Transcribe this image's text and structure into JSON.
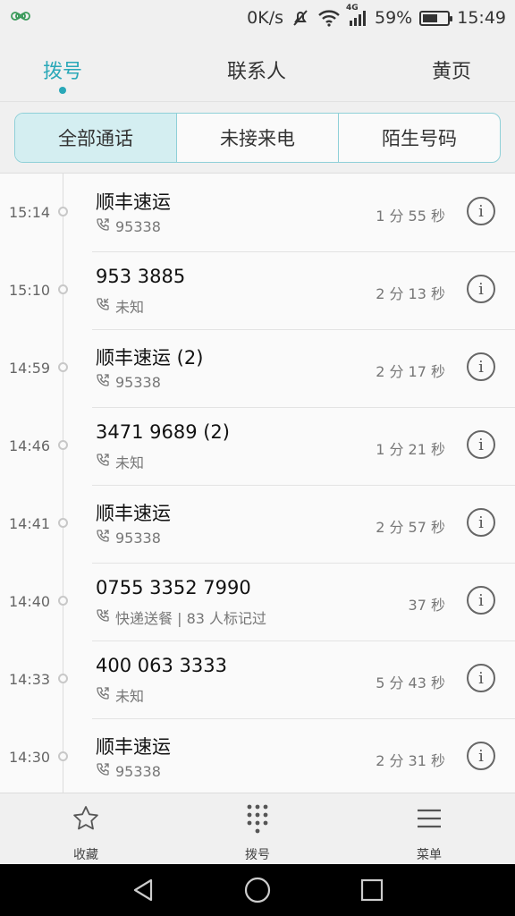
{
  "status_bar": {
    "app_icon": "infinity-icon",
    "speed": "0K/s",
    "network": "4G",
    "battery": "59%",
    "battery_level": 0.59,
    "time": "15:49"
  },
  "tabs": [
    {
      "label": "拨号",
      "active": true
    },
    {
      "label": "联系人",
      "active": false
    },
    {
      "label": "黄页",
      "active": false
    }
  ],
  "filter": [
    {
      "label": "全部通话",
      "active": true
    },
    {
      "label": "未接来电",
      "active": false
    },
    {
      "label": "陌生号码",
      "active": false
    }
  ],
  "calls": [
    {
      "time": "15:14",
      "name": "顺丰速运",
      "direction": "outgoing",
      "detail": "95338",
      "duration": "1 分 55 秒"
    },
    {
      "time": "15:10",
      "name": "953 3885",
      "direction": "incoming",
      "detail": "未知",
      "duration": "2 分 13 秒"
    },
    {
      "time": "14:59",
      "name": "顺丰速运 (2)",
      "direction": "outgoing",
      "detail": "95338",
      "duration": "2 分 17 秒"
    },
    {
      "time": "14:46",
      "name": "3471 9689 (2)",
      "direction": "outgoing",
      "detail": "未知",
      "duration": "1 分 21 秒"
    },
    {
      "time": "14:41",
      "name": "顺丰速运",
      "direction": "outgoing",
      "detail": "95338",
      "duration": "2 分 57 秒"
    },
    {
      "time": "14:40",
      "name": "0755 3352 7990",
      "direction": "incoming",
      "detail": "快递送餐 | 83 人标记过",
      "duration": "37 秒"
    },
    {
      "time": "14:33",
      "name": "400 063 3333",
      "direction": "outgoing",
      "detail": "未知",
      "duration": "5 分 43 秒"
    },
    {
      "time": "14:30",
      "name": "顺丰速运",
      "direction": "outgoing",
      "detail": "95338",
      "duration": "2 分 31 秒"
    }
  ],
  "actions": [
    {
      "label": "收藏",
      "icon": "star-icon"
    },
    {
      "label": "拨号",
      "icon": "dialpad-icon"
    },
    {
      "label": "菜单",
      "icon": "menu-icon"
    }
  ],
  "nav": [
    "back-icon",
    "home-icon",
    "recents-icon"
  ]
}
